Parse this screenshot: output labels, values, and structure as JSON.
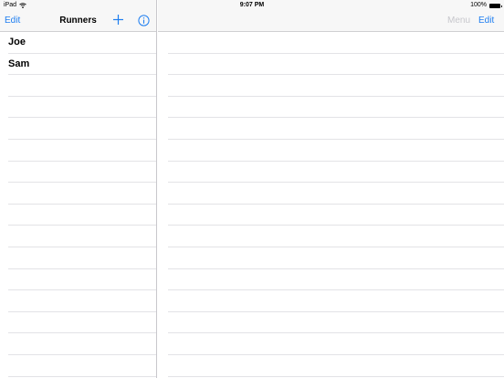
{
  "status_bar": {
    "device": "iPad",
    "wifi_icon": "wifi-icon",
    "time": "9:07 PM",
    "battery": "100%"
  },
  "master": {
    "nav": {
      "edit_label": "Edit",
      "title": "Runners",
      "add_icon": "plus-icon",
      "info_icon": "info-icon"
    },
    "runners": [
      "Joe",
      "Sam"
    ],
    "empty_rows": 14
  },
  "detail": {
    "nav": {
      "menu_label": "Menu",
      "edit_label": "Edit"
    },
    "empty_rows": 16
  },
  "colors": {
    "accent": "#1e7ef0",
    "disabled": "#c7c7cc",
    "separator": "#e3e3e6",
    "navbar": "#f7f7f7"
  }
}
